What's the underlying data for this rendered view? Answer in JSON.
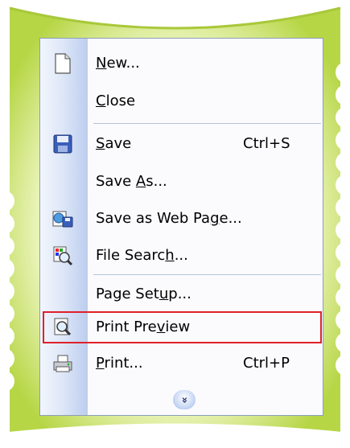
{
  "menu": {
    "items": [
      {
        "label_pre": "",
        "label_key": "N",
        "label_post": "ew...",
        "shortcut": "",
        "icon": "new-document-icon"
      },
      {
        "label_pre": "",
        "label_key": "C",
        "label_post": "lose",
        "shortcut": "",
        "icon": ""
      },
      {
        "label_pre": "",
        "label_key": "S",
        "label_post": "ave",
        "shortcut": "Ctrl+S",
        "icon": "save-disk-icon"
      },
      {
        "label_pre": "Save ",
        "label_key": "A",
        "label_post": "s...",
        "shortcut": "",
        "icon": ""
      },
      {
        "label_pre": "Save as Web Pa",
        "label_key": "g",
        "label_post": "e...",
        "shortcut": "",
        "icon": "save-as-web-page-icon"
      },
      {
        "label_pre": "File Searc",
        "label_key": "h",
        "label_post": "...",
        "shortcut": "",
        "icon": "file-search-icon"
      },
      {
        "label_pre": "Page Set",
        "label_key": "u",
        "label_post": "p...",
        "shortcut": "",
        "icon": ""
      },
      {
        "label_pre": "Print Pre",
        "label_key": "v",
        "label_post": "iew",
        "shortcut": "",
        "icon": "print-preview-icon"
      },
      {
        "label_pre": "",
        "label_key": "P",
        "label_post": "rint...",
        "shortcut": "Ctrl+P",
        "icon": "printer-icon"
      }
    ],
    "expand_glyph": "»",
    "highlighted_item": "Print Preview"
  },
  "colors": {
    "frame_green": "#b4d23e",
    "frame_light": "#f7fbe3",
    "gutter": "#c4d3f0",
    "highlight_border": "#e0202a"
  }
}
